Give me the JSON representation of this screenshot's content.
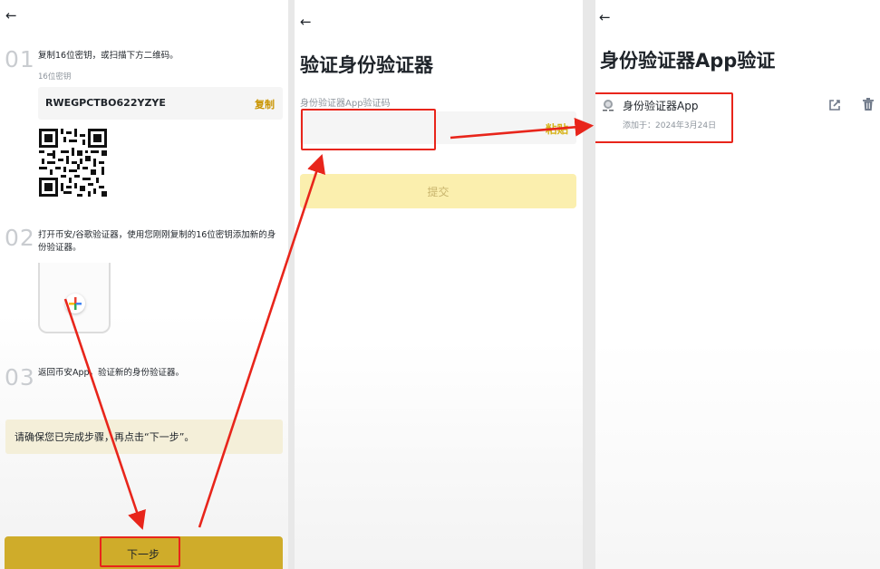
{
  "panel1": {
    "back_icon": "arrow-left-icon",
    "step1_num": "01",
    "step1_text": "复制16位密钥，或扫描下方二维码。",
    "key_label": "16位密钥",
    "key_value": "RWEGPCTBO622YZYE",
    "copy_label": "复制",
    "step2_num": "02",
    "step2_text_line1": "打开币安/谷歌验证器，使用您刚刚复制的16位密钥添加新的身",
    "step2_text_line2": "份验证器。",
    "step3_num": "03",
    "step3_text": "返回币安App，验证新的身份验证器。",
    "notice_text": "请确保您已完成步骤，再点击“下一步”。",
    "next_button": "下一步"
  },
  "panel2": {
    "back_icon": "arrow-left-icon",
    "title": "验证身份验证器",
    "field_label": "身份验证器App验证码",
    "field_value": "",
    "paste_label": "粘贴",
    "submit_label": "提交"
  },
  "panel3": {
    "back_icon": "arrow-left-icon",
    "title": "身份验证器App验证",
    "item_name": "身份验证器App",
    "item_date": "添加于：2024年3月24日",
    "edit_icon": "edit-icon",
    "delete_icon": "trash-icon"
  },
  "colors": {
    "accent_yellow": "#cfac2a",
    "annotation_red": "#e8251b",
    "link_gold": "#c99400"
  }
}
